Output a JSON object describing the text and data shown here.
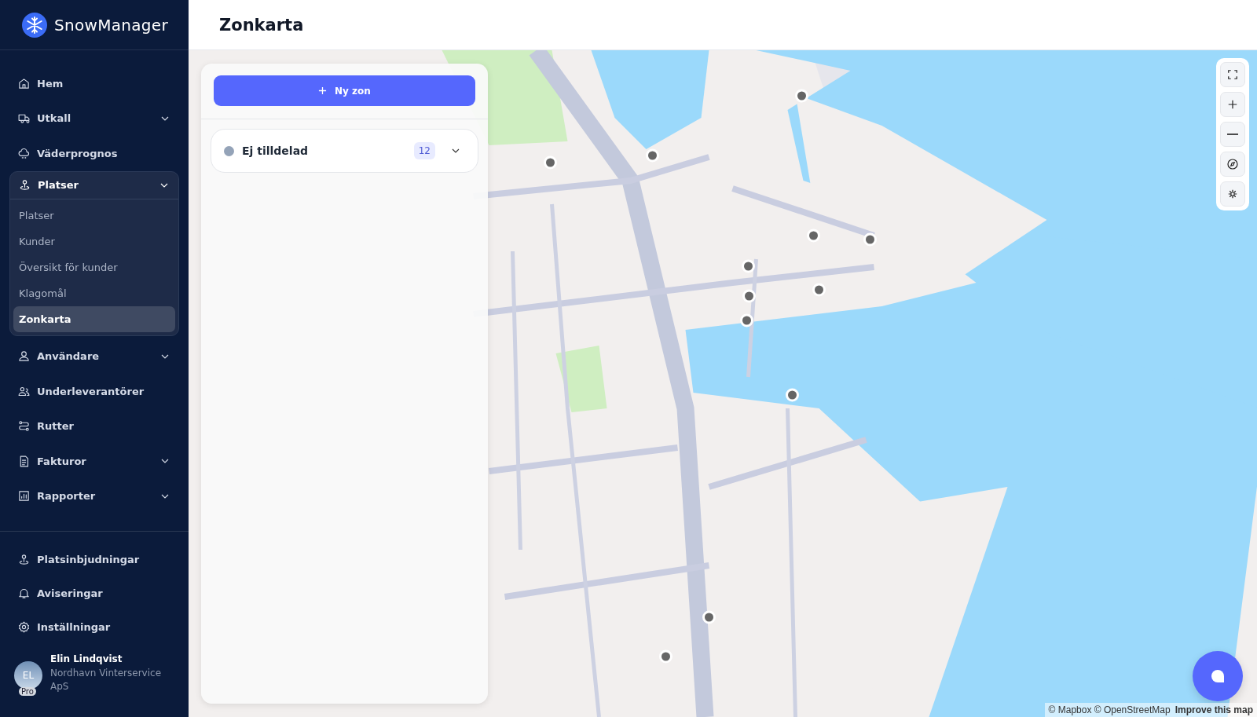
{
  "brand": {
    "name": "SnowManager"
  },
  "nav": [
    {
      "label": "Hem",
      "kind": "home",
      "has_submenu": false,
      "expanded": false
    },
    {
      "label": "Utkall",
      "kind": "truck",
      "has_submenu": true,
      "expanded": false
    },
    {
      "label": "Väderprognos",
      "kind": "cloud",
      "has_submenu": false,
      "expanded": false
    },
    {
      "label": "Platser",
      "kind": "pin",
      "has_submenu": true,
      "expanded": true,
      "children": [
        {
          "label": "Platser",
          "selected": false
        },
        {
          "label": "Kunder",
          "selected": false
        },
        {
          "label": "Översikt för kunder",
          "selected": false
        },
        {
          "label": "Klagomål",
          "selected": false
        },
        {
          "label": "Zonkarta",
          "selected": true
        }
      ]
    },
    {
      "label": "Användare",
      "kind": "user",
      "has_submenu": true,
      "expanded": false
    },
    {
      "label": "Underleverantörer",
      "kind": "users",
      "has_submenu": false,
      "expanded": false
    },
    {
      "label": "Rutter",
      "kind": "route",
      "has_submenu": false,
      "expanded": false
    },
    {
      "label": "Fakturor",
      "kind": "doc",
      "has_submenu": true,
      "expanded": false
    },
    {
      "label": "Rapporter",
      "kind": "chart",
      "has_submenu": true,
      "expanded": false
    }
  ],
  "nav_bottom": [
    {
      "label": "Platsinbjudningar",
      "kind": "pin"
    },
    {
      "label": "Aviseringar",
      "kind": "bell"
    },
    {
      "label": "Inställningar",
      "kind": "gear"
    }
  ],
  "user": {
    "initials": "EL",
    "badge": "Pro",
    "name": "Elin Lindqvist",
    "company": "Nordhavn Vinterservice ApS"
  },
  "page_title": "Zonkarta",
  "panel": {
    "new_zone_button": "Ny zon",
    "zones": [
      {
        "name": "Ej tilldelad",
        "count": "12",
        "color": "#94a3b8",
        "expanded": false
      }
    ]
  },
  "attribution": {
    "credits": "© Mapbox © OpenStreetMap",
    "link": "Improve this map"
  }
}
